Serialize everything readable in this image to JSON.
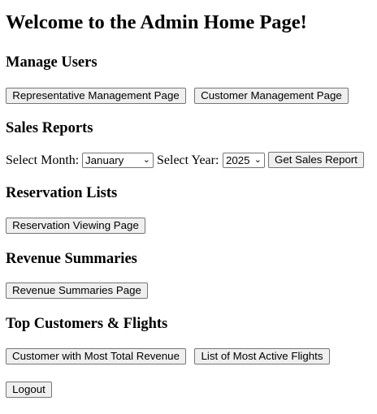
{
  "page": {
    "title": "Welcome to the Admin Home Page!"
  },
  "manage_users": {
    "heading": "Manage Users",
    "rep_button": "Representative Management Page",
    "cust_button": "Customer Management Page"
  },
  "sales_reports": {
    "heading": "Sales Reports",
    "month_label": "Select Month:",
    "month_value": "January",
    "year_label": "Select Year:",
    "year_value": "2025",
    "submit_button": "Get Sales Report"
  },
  "reservation_lists": {
    "heading": "Reservation Lists",
    "view_button": "Reservation Viewing Page"
  },
  "revenue_summaries": {
    "heading": "Revenue Summaries",
    "button": "Revenue Summaries Page"
  },
  "top_customers": {
    "heading": "Top Customers & Flights",
    "customer_button": "Customer with Most Total Revenue",
    "flights_button": "List of Most Active Flights"
  },
  "logout": {
    "button": "Logout"
  },
  "icons": {
    "dropdown": "chevron-down-icon"
  }
}
